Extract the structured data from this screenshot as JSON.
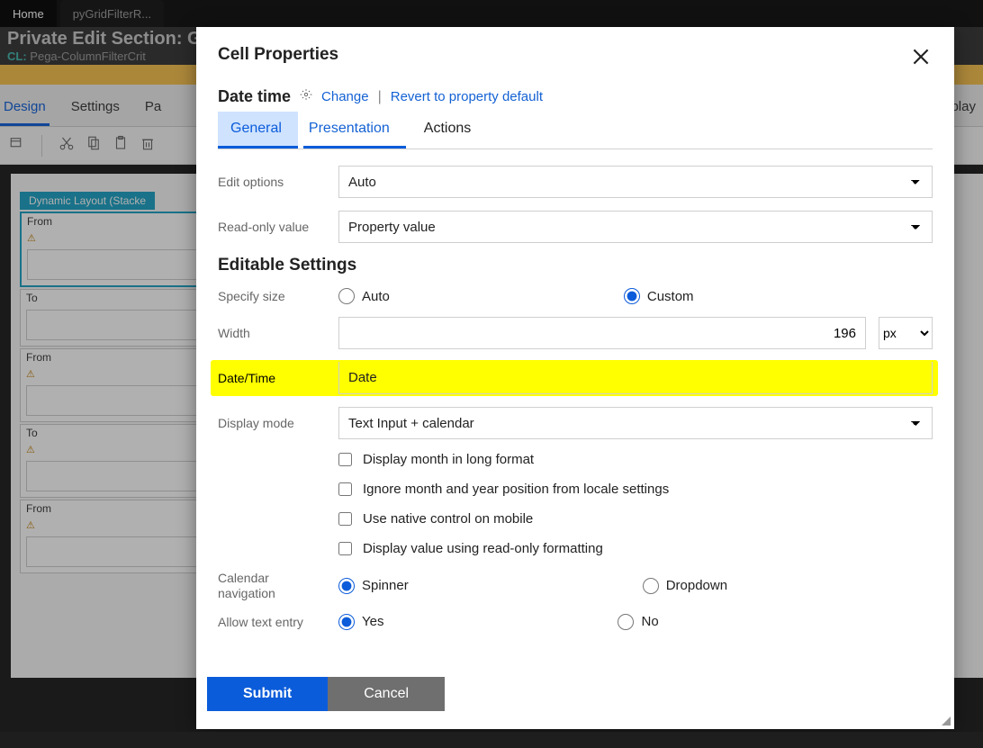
{
  "tabs": [
    {
      "label": "Home"
    },
    {
      "label": "pyGridFilterR..."
    }
  ],
  "header": {
    "title": "Private Edit  Section: Gri",
    "cl_label": "CL:",
    "cl_value": "Pega-ColumnFilterCrit"
  },
  "nav": [
    {
      "label": "Design"
    },
    {
      "label": "Settings"
    },
    {
      "label": "Pa"
    }
  ],
  "bg_right_text": "play",
  "canvas": {
    "layout_label": "Dynamic Layout (Stacke",
    "fields": [
      "From",
      "To",
      "From",
      "To",
      "From"
    ],
    "warn_glyph": "⚠"
  },
  "modal": {
    "title": "Cell Properties",
    "type_label": "Date time",
    "change": "Change",
    "revert": "Revert to property default",
    "tabs": [
      "General",
      "Presentation",
      "Actions"
    ],
    "edit_options": {
      "label": "Edit options",
      "value": "Auto"
    },
    "readonly": {
      "label": "Read-only value",
      "value": "Property value"
    },
    "section_title": "Editable Settings",
    "specify_size": {
      "label": "Specify size",
      "auto": "Auto",
      "custom": "Custom"
    },
    "width": {
      "label": "Width",
      "value": "196",
      "unit": "px"
    },
    "datetime": {
      "label": "Date/Time",
      "value": "Date"
    },
    "display_mode": {
      "label": "Display mode",
      "value": "Text Input + calendar"
    },
    "checks": [
      "Display month in long format",
      "Ignore month and year position from locale settings",
      "Use native control on mobile",
      "Display value using read-only formatting"
    ],
    "calendar_nav": {
      "label": "Calendar navigation",
      "spinner": "Spinner",
      "dropdown": "Dropdown"
    },
    "allow_text": {
      "label": "Allow text entry",
      "yes": "Yes",
      "no": "No"
    },
    "submit": "Submit",
    "cancel": "Cancel"
  }
}
